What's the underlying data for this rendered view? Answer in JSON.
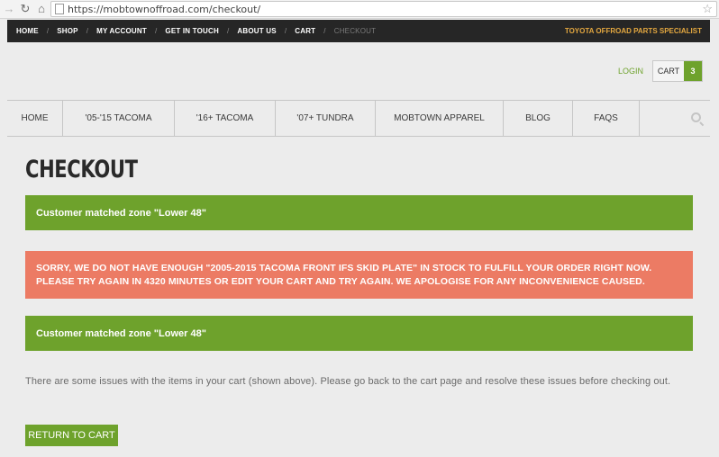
{
  "browser": {
    "url": "https://mobtownoffroad.com/checkout/",
    "icons": [
      "back-icon",
      "reload-icon",
      "home-icon",
      "page-icon",
      "bookmark-star-icon"
    ]
  },
  "topbar": {
    "items": [
      "Home",
      "Shop",
      "My Account",
      "Get in Touch",
      "About Us",
      "Cart",
      "Checkout"
    ],
    "separator": "/",
    "tagline": "Toyota Offroad Parts Specialist"
  },
  "account": {
    "login_label": "Login",
    "cart_label": "Cart",
    "cart_count": "3"
  },
  "mainnav": {
    "items": [
      "Home",
      "'05-'15 Tacoma",
      "'16+ Tacoma",
      "'07+ Tundra",
      "Mobtown Apparel",
      "Blog",
      "FAQs"
    ]
  },
  "main": {
    "title": "Checkout",
    "notices": [
      "Customer matched zone \"Lower 48\"",
      "Sorry, we do not have enough \"2005-2015 Tacoma Front IFS Skid Plate\" in stock to fulfill your order right now. Please try again in 4320 minutes or edit your cart and try again. We apologise for any inconvenience caused.",
      "Customer matched zone \"Lower 48\""
    ],
    "issues_text": "There are some issues with the items in your cart (shown above). Please go back to the cart page and resolve these issues before checking out.",
    "return_button": "Return to Cart"
  },
  "colors": {
    "accent_green": "#6ea22c",
    "error_red": "#ec7b64",
    "topbar_bg": "#262626",
    "tagline_orange": "#e4a840"
  }
}
